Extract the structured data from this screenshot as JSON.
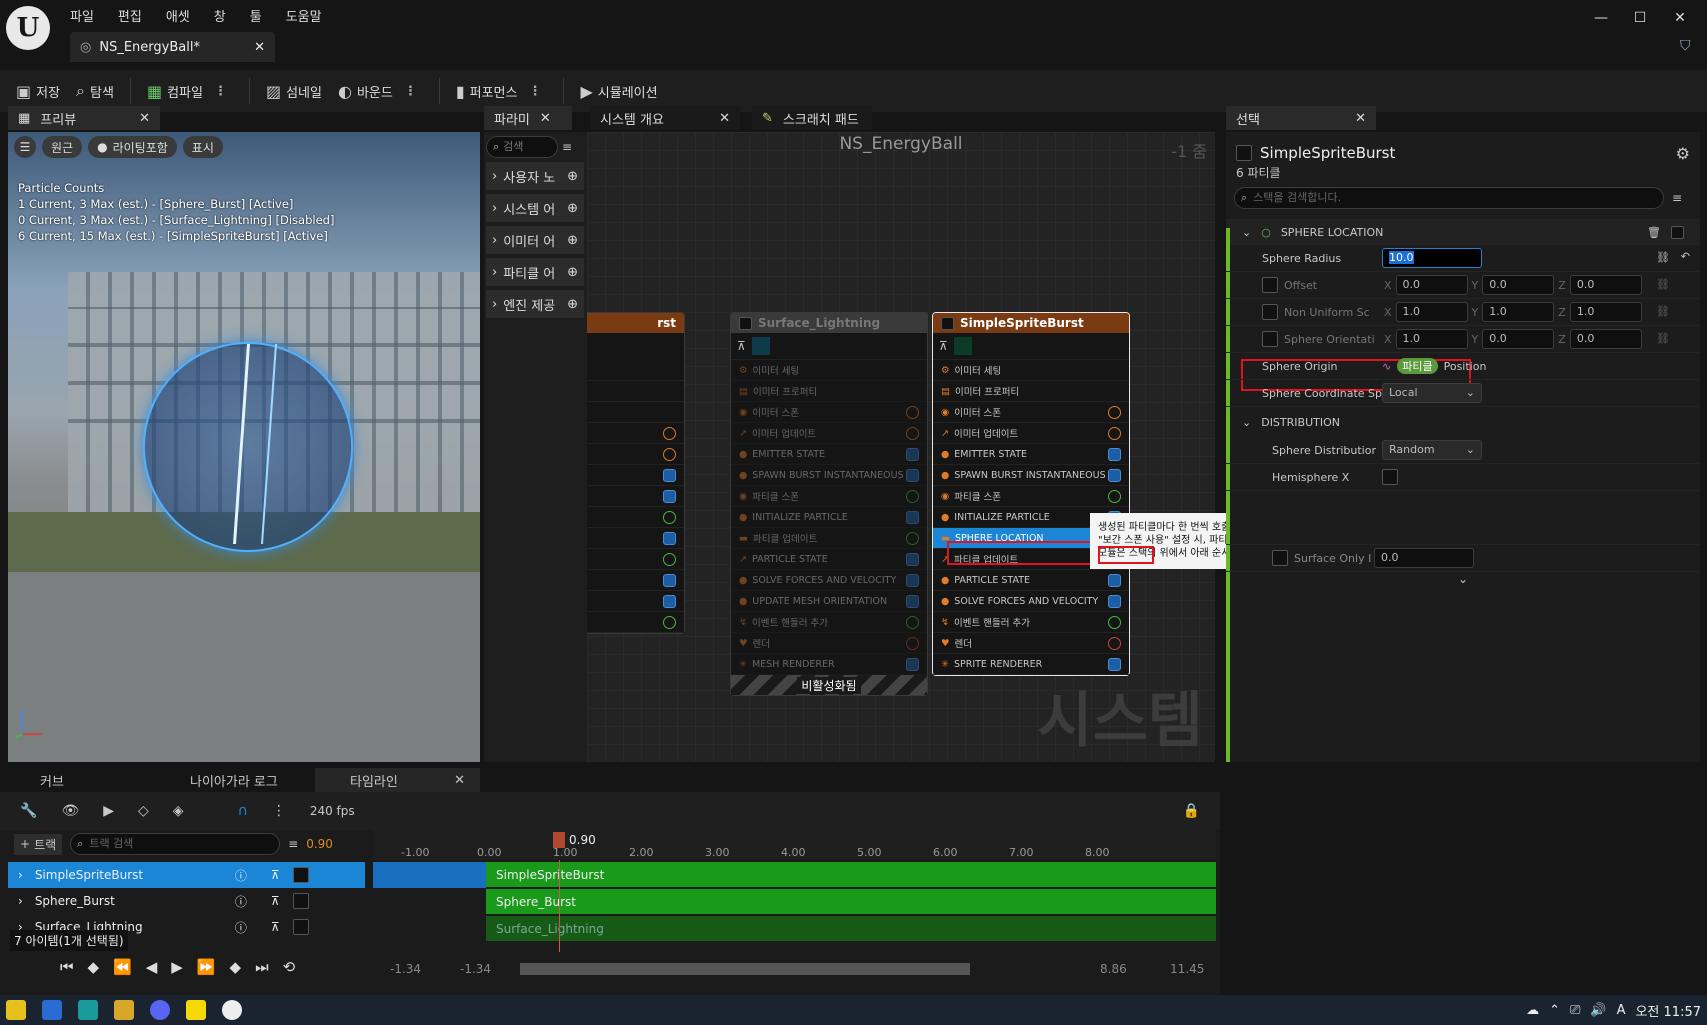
{
  "app": {
    "doc_tab": "NS_EnergyBall*",
    "menus": [
      "파일",
      "편집",
      "애셋",
      "창",
      "툴",
      "도움말"
    ]
  },
  "toolbar": {
    "save": "저장",
    "browse": "탐색",
    "compile": "컴파일",
    "thumbnail": "섬네일",
    "bounds": "바운드",
    "performance": "퍼포먼스",
    "simulation": "시뮬레이션"
  },
  "preview": {
    "tab": "프리뷰",
    "perspective": "원근",
    "lit": "라이팅포함",
    "show": "표시",
    "counts_title": "Particle Counts",
    "counts": [
      "1 Current, 3 Max (est.) - [Sphere_Burst] [Active]",
      "0 Current, 3 Max (est.) - [Surface_Lightning] [Disabled]",
      "6 Current, 15 Max (est.) - [SimpleSpriteBurst] [Active]"
    ]
  },
  "graph_tabs": {
    "params": "파라미",
    "overview": "시스템 개요",
    "scratch": "스크래치 패드"
  },
  "graph": {
    "title": "NS_EnergyBall",
    "zoom": "-1 줌",
    "watermark": "시스템",
    "disabled_label": "비활성화됨"
  },
  "palette": {
    "search": "검색",
    "items": [
      "사용자 노",
      "시스템 어",
      "이미터 어",
      "파티클 어",
      "엔진 제공"
    ]
  },
  "node_left": {
    "title": "rst",
    "rows": [
      "",
      "",
      "",
      "INSTANTANEOUS",
      "",
      "TICLE",
      "",
      "E",
      "AND VELOCITY",
      "",
      "",
      "R"
    ]
  },
  "node_mid": {
    "title": "Surface_Lightning",
    "rows": [
      "이미터 세팅",
      "이미터 프로퍼티",
      "이미터 스폰",
      "이미터 업데이트",
      "EMITTER STATE",
      "SPAWN BURST INSTANTANEOUS",
      "파티클 스폰",
      "INITIALIZE PARTICLE",
      "파티클 업데이트",
      "PARTICLE STATE",
      "SOLVE FORCES AND VELOCITY",
      "UPDATE MESH ORIENTATION",
      "이벤트 핸들러 추가",
      "렌더",
      "MESH RENDERER"
    ]
  },
  "node_right": {
    "title": "SimpleSpriteBurst",
    "rows": [
      "이미터 세팅",
      "이미터 프로퍼티",
      "이미터 스폰",
      "이미터 업데이트",
      "EMITTER STATE",
      "SPAWN BURST INSTANTANEOUS",
      "파티클 스폰",
      "INITIALIZE PARTICLE",
      "SPHERE LOCATION",
      "파티클 업데이트",
      "PARTICLE STATE",
      "SOLVE FORCES AND VELOCITY",
      "이벤트 핸들러 추가",
      "렌더",
      "SPRITE RENDERER"
    ]
  },
  "tooltip": {
    "lines": [
      "생성된 파티클마다 한 번씩 호출합니다. 이 스테이지의 모듈은 각 파티클의 초기값을 구성합니다.",
      "\"보간 스폰 사용\" 설정 시, 파티클 스폰 스테이지 이후 파티클 업데이트 스테이지도 실행합니다.",
      "모듈은 스택의 위에서 아래 순서로 실행됩니다."
    ]
  },
  "details": {
    "tab": "선택",
    "emitter": "SimpleSpriteBurst",
    "count": "6 파티클",
    "search": "스택을 검색합니다.",
    "section": "SPHERE LOCATION",
    "radius_label": "Sphere Radius",
    "radius": "10.0",
    "offset": "Offset",
    "nonuniform": "Non Uniform Sc",
    "orient": "Sphere Orientati",
    "x": "X",
    "y": "Y",
    "z": "Z",
    "off_x": "0.0",
    "off_y": "0.0",
    "off_z": "0.0",
    "nu_x": "1.0",
    "nu_y": "1.0",
    "nu_z": "1.0",
    "or_x": "1.0",
    "or_y": "0.0",
    "or_z": "0.0",
    "origin": "Sphere Origin",
    "origin_tag": "파티클",
    "origin_val": "Position",
    "coord": "Sphere Coordinate Sp",
    "coord_val": "Local",
    "dist_section": "DISTRIBUTION",
    "dist": "Sphere Distributior",
    "dist_val": "Random",
    "hemi": "Hemisphere X",
    "surface": "Surface Only I",
    "surface_val": "0.0"
  },
  "lower_tabs": {
    "curves": "커브",
    "log": "나이아가라 로그",
    "timeline": "타임라인"
  },
  "seq": {
    "fps": "240 fps",
    "track_btn": "트랙",
    "search": "트랙 검색",
    "time": "0.90",
    "playhead": "0.90",
    "status": "7 아이템(1개 선택됨)",
    "tracks": [
      "SimpleSpriteBurst",
      "Sphere_Burst",
      "Surface_Lightning"
    ],
    "ticks": [
      "-1.00",
      "0.00",
      "1.00",
      "2.00",
      "3.00",
      "4.00",
      "5.00",
      "6.00",
      "7.00",
      "8.00"
    ],
    "range": [
      "-1.34",
      "-1.34",
      "8.86",
      "11.45"
    ]
  },
  "taskbar": {
    "clock": "오전 11:57",
    "ime": "A"
  },
  "colors": {
    "accent": "#1b86d6",
    "select_red": "#e0141e",
    "green": "#1a9a1a",
    "node_orange": "#9a4a14"
  }
}
